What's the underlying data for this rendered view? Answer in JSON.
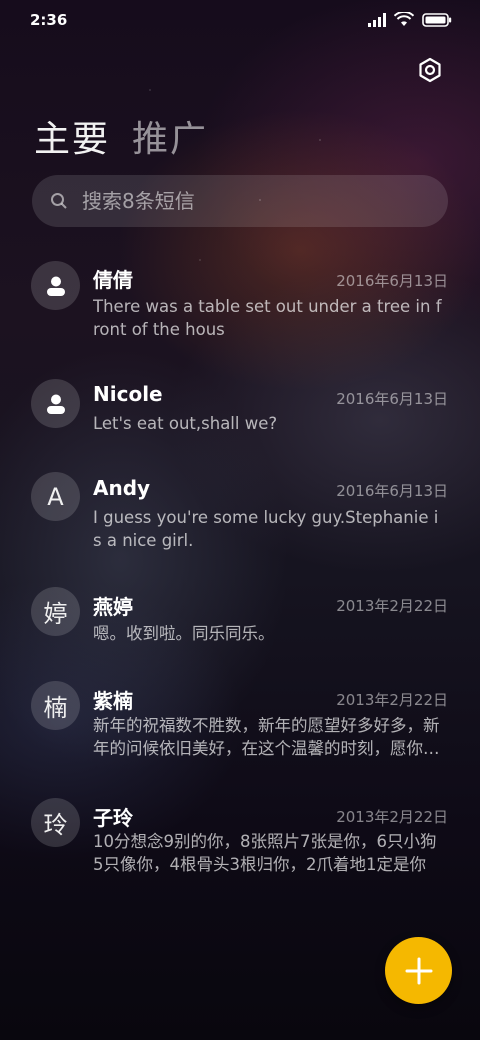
{
  "status_bar": {
    "time": "2:36",
    "icons": [
      "signal-icon",
      "wifi-icon",
      "battery-icon"
    ]
  },
  "header": {
    "settings_icon": "gear-icon",
    "tabs": [
      {
        "label": "主要",
        "active": true
      },
      {
        "label": "推广",
        "active": false
      }
    ]
  },
  "search": {
    "placeholder": "搜索8条短信",
    "icon": "search-icon"
  },
  "messages": [
    {
      "avatar": "",
      "avatar_icon": "person-icon",
      "name": "倩倩",
      "date": "2016年6月13日",
      "preview": "There was a table set out under a tree in front of the hous"
    },
    {
      "avatar": "",
      "avatar_icon": "person-icon",
      "name": "Nicole",
      "date": "2016年6月13日",
      "preview": "Let's eat out,shall we?"
    },
    {
      "avatar": "A",
      "name": "Andy",
      "date": "2016年6月13日",
      "preview": "I guess you're some lucky guy.Stephanie is a nice girl."
    },
    {
      "avatar": "婷",
      "name": "燕婷",
      "date": "2013年2月22日",
      "preview": "嗯。收到啦。同乐同乐。"
    },
    {
      "avatar": "楠",
      "name": "紫楠",
      "date": "2013年2月22日",
      "preview": "新年的祝福数不胜数，新年的愿望好多好多，新年的问候依旧美好，在这个温馨的时刻，愿你新年快乐"
    },
    {
      "avatar": "玲",
      "name": "子玲",
      "date": "2013年2月22日",
      "preview": "10分想念9别的你，8张照片7张是你，6只小狗5只像你，4根骨头3根归你，2爪着地1定是你"
    }
  ],
  "fab": {
    "icon": "plus-icon"
  },
  "colors": {
    "accent": "#f5b800"
  }
}
